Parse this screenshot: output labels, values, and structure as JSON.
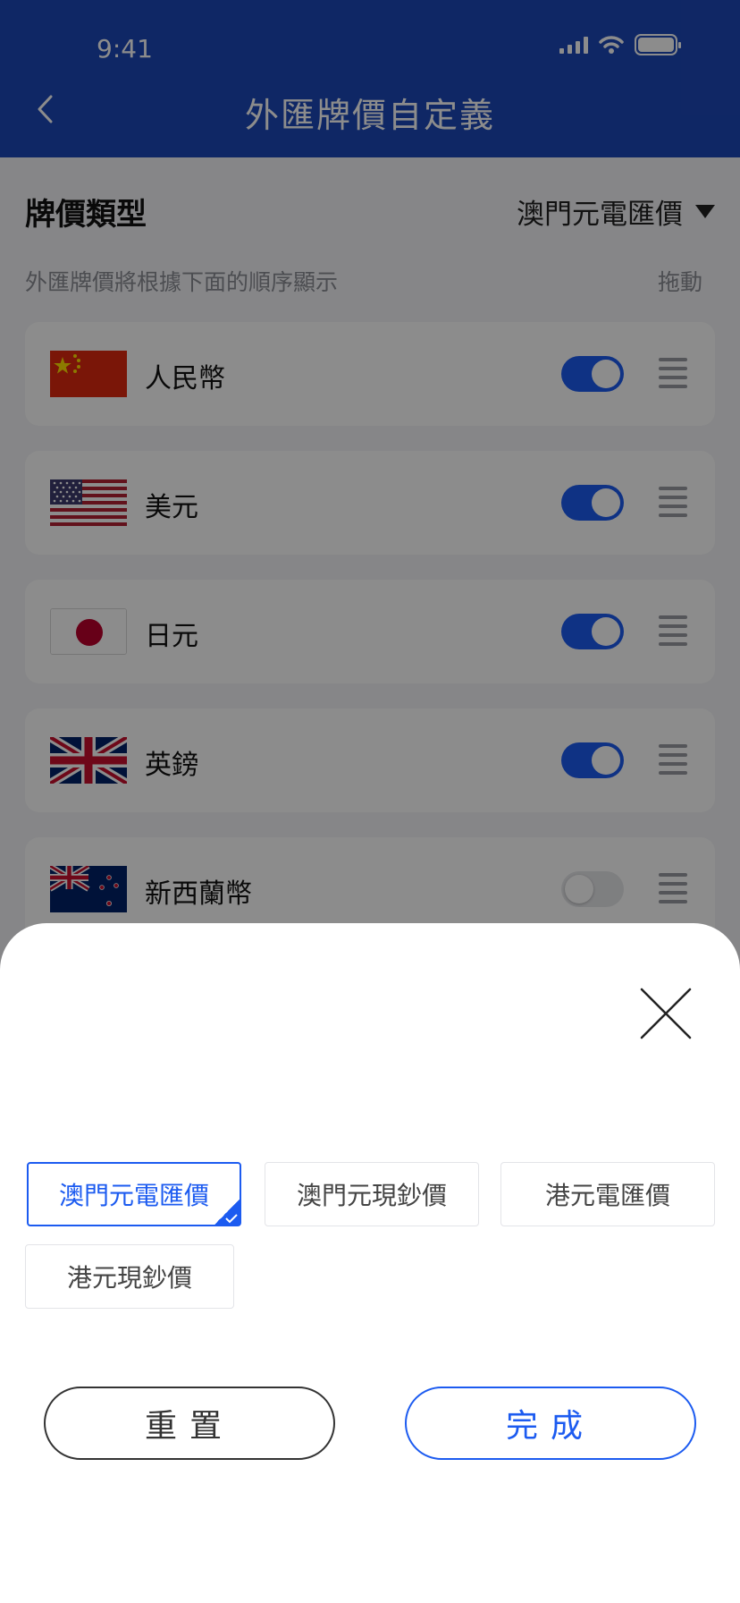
{
  "status_bar": {
    "time": "9:41"
  },
  "header": {
    "title": "外匯牌價自定義"
  },
  "price_type": {
    "label": "牌價類型",
    "selected": "澳門元電匯價"
  },
  "hint": {
    "text": "外匯牌價將根據下面的順序顯示",
    "drag_label": "拖動"
  },
  "currencies": [
    {
      "name": "人民幣",
      "flag": "china-flag-icon",
      "enabled": true
    },
    {
      "name": "美元",
      "flag": "usa-flag-icon",
      "enabled": true
    },
    {
      "name": "日元",
      "flag": "japan-flag-icon",
      "enabled": true
    },
    {
      "name": "英鎊",
      "flag": "uk-flag-icon",
      "enabled": true
    },
    {
      "name": "新西蘭幣",
      "flag": "new-zealand-flag-icon",
      "enabled": false
    }
  ],
  "sheet": {
    "options": [
      {
        "label": "澳門元電匯價",
        "selected": true
      },
      {
        "label": "澳門元現鈔價",
        "selected": false
      },
      {
        "label": "港元電匯價",
        "selected": false
      },
      {
        "label": "港元現鈔價",
        "selected": false
      }
    ],
    "reset_label": "重置",
    "done_label": "完成"
  },
  "colors": {
    "brand": "#1d47b8",
    "accent": "#1c5bf0"
  }
}
